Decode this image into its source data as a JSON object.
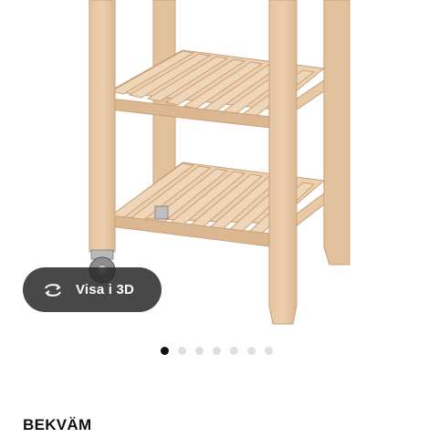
{
  "product": {
    "name": "BEKVÄM",
    "image_alt": "kitchen-cart-product-image"
  },
  "viewer": {
    "label": "Visa i 3D",
    "icon": "rotate-3d-icon"
  },
  "carousel": {
    "total": 7,
    "active_index": 0
  },
  "colors": {
    "wood_light": "#e9c9a5",
    "wood_dark": "#cda07b",
    "button_bg": "#2a2a2a"
  }
}
